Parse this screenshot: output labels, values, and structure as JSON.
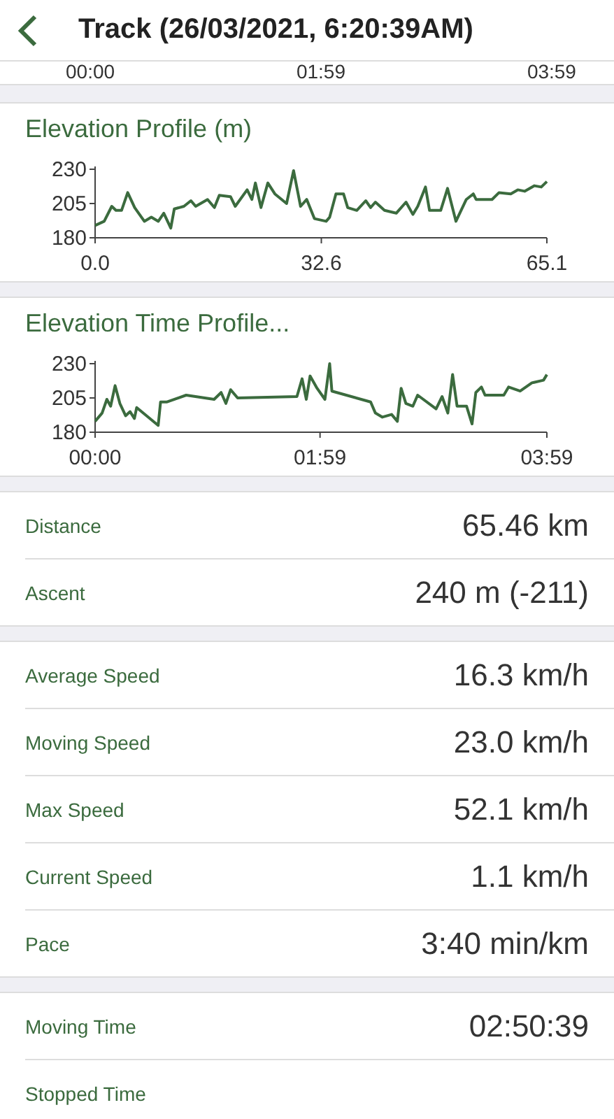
{
  "header": {
    "title": "Track (26/03/2021, 6:20:39AM)"
  },
  "top_axis_labels": [
    "00:00",
    "01:59",
    "03:59"
  ],
  "charts": [
    {
      "title": "Elevation Profile (m)",
      "chart_data": {
        "type": "line",
        "x": [
          0,
          1.3,
          2.4,
          3.0,
          3.8,
          4.7,
          5.7,
          7.1,
          8.1,
          9.1,
          9.9,
          10.9,
          11.4,
          12.8,
          13.8,
          14.5,
          16.2,
          17.2,
          17.9,
          19.5,
          20.2,
          21.9,
          22.6,
          23.1,
          23.9,
          24.9,
          25.9,
          27.6,
          28.6,
          29.6,
          30.5,
          31.6,
          33.3,
          33.8,
          34.7,
          35.8,
          36.4,
          37.7,
          39.0,
          39.7,
          40.4,
          41.7,
          43.4,
          44.8,
          45.8,
          46.5,
          47.6,
          48.2,
          49.8,
          50.8,
          52.0,
          53.5,
          54.5,
          54.9,
          57.2,
          58.2,
          59.9,
          60.9,
          61.9,
          63.3,
          64.3,
          65.1
        ],
        "series": [
          {
            "color": "#3b6b3e",
            "values": [
              189,
              192,
              203,
              200,
              200,
              213,
              202,
              192,
              195,
              192,
              198,
              187,
              201,
              203,
              207,
              203,
              208,
              202,
              211,
              210,
              203,
              215,
              208,
              220,
              202,
              220,
              212,
              205,
              229,
              203,
              208,
              194,
              192,
              195,
              212,
              212,
              202,
              200,
              207,
              202,
              206,
              200,
              198,
              206,
              197,
              203,
              217,
              200,
              200,
              216,
              192,
              208,
              212,
              208,
              208,
              213,
              212,
              215,
              214,
              218,
              217,
              221
            ]
          }
        ],
        "xlim": [
          0,
          65.1
        ],
        "ylim": [
          180,
          230
        ],
        "xticks": [
          {
            "value": 0,
            "label": "0.0"
          },
          {
            "value": 32.6,
            "label": "32.6"
          },
          {
            "value": 65.1,
            "label": "65.1"
          }
        ],
        "yticks": [
          180,
          205,
          230
        ]
      }
    },
    {
      "title": "Elevation Time Profile...",
      "chart_data": {
        "type": "line",
        "x": [
          0,
          3.7,
          6.2,
          8.2,
          10.6,
          13.1,
          16.1,
          18.5,
          20.8,
          22.0,
          33.4,
          34.6,
          37.8,
          48.2,
          63.0,
          66.7,
          69.2,
          71.7,
          75.4,
          106.8,
          109.5,
          111.7,
          113.7,
          117.4,
          121.6,
          124.1,
          125.3,
          145.8,
          148.3,
          152.0,
          156.9,
          159.9,
          161.9,
          164.4,
          168.1,
          170.6,
          180.4,
          183.6,
          186.6,
          189.1,
          191.5,
          196.5,
          199.4,
          201.4,
          204.4,
          206.3,
          216.2,
          218.7,
          224.9,
          231.1,
          237.2,
          239
        ],
        "series": [
          {
            "color": "#3b6b3e",
            "values": [
              188,
              194,
              204,
              199,
              214,
              201,
              192,
              195,
              190,
              198,
              185,
              202,
              202,
              207,
              204,
              209,
              201,
              211,
              205,
              206,
              219,
              204,
              221,
              212,
              204,
              230,
              210,
              202,
              194,
              191,
              193,
              188,
              212,
              201,
              199,
              207,
              197,
              206,
              194,
              222,
              199,
              199,
              186,
              209,
              213,
              207,
              207,
              213,
              210,
              216,
              218,
              222
            ]
          }
        ],
        "xlim": [
          0,
          239
        ],
        "ylim": [
          180,
          230
        ],
        "xticks": [
          {
            "value": 0,
            "label": "00:00"
          },
          {
            "value": 119,
            "label": "01:59"
          },
          {
            "value": 239,
            "label": "03:59"
          }
        ],
        "yticks": [
          180,
          205,
          230
        ]
      }
    }
  ],
  "stat_groups": [
    [
      {
        "label": "Distance",
        "value": "65.46 km"
      },
      {
        "label": "Ascent",
        "value": "240 m (-211)"
      }
    ],
    [
      {
        "label": "Average Speed",
        "value": "16.3 km/h"
      },
      {
        "label": "Moving Speed",
        "value": "23.0 km/h"
      },
      {
        "label": "Max Speed",
        "value": "52.1 km/h"
      },
      {
        "label": "Current Speed",
        "value": "1.1 km/h"
      },
      {
        "label": "Pace",
        "value": "3:40 min/km"
      }
    ],
    [
      {
        "label": "Moving Time",
        "value": "02:50:39"
      },
      {
        "label": "Stopped Time"
      }
    ]
  ]
}
